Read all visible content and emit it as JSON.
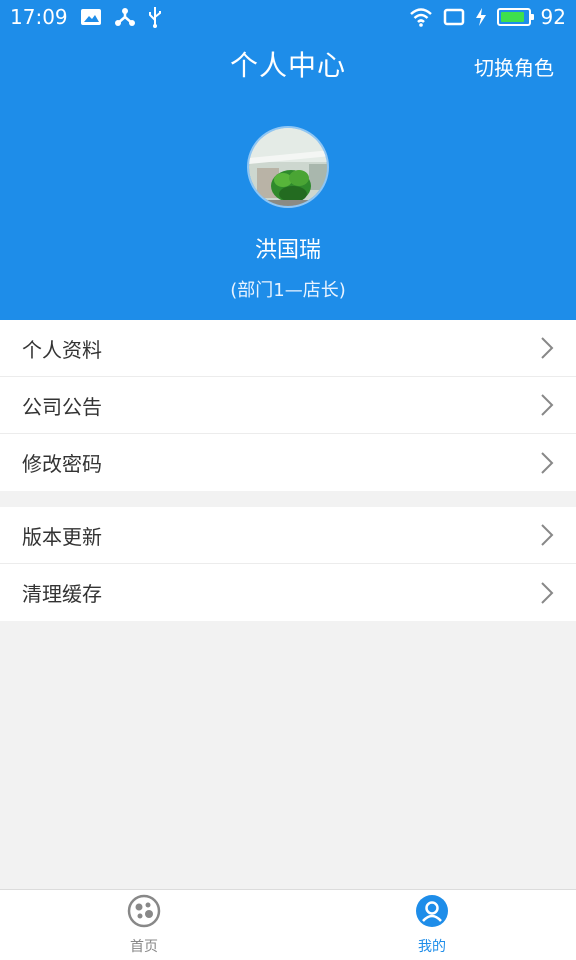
{
  "status_bar": {
    "time": "17:09",
    "battery_level": "92",
    "battery_fraction": 0.92,
    "icons": [
      "image-icon",
      "tether-icon",
      "usb-icon",
      "wifi-icon",
      "screen-icon",
      "charging-icon",
      "battery-icon"
    ]
  },
  "header": {
    "title": "个人中心",
    "switch_role_label": "切换角色",
    "user_name": "洪国瑞",
    "department": "(部门1—店长)"
  },
  "menu": {
    "group1": [
      {
        "label": "个人资料"
      },
      {
        "label": "公司公告"
      },
      {
        "label": "修改密码"
      }
    ],
    "group2": [
      {
        "label": "版本更新"
      },
      {
        "label": "清理缓存"
      }
    ]
  },
  "tabbar": {
    "tabs": [
      {
        "label": "首页",
        "icon": "home-icon",
        "active": false
      },
      {
        "label": "我的",
        "icon": "profile-icon",
        "active": true
      }
    ]
  },
  "colors": {
    "accent": "#1e8de9",
    "background": "#f2f2f2",
    "inactive_tab": "#888888"
  }
}
